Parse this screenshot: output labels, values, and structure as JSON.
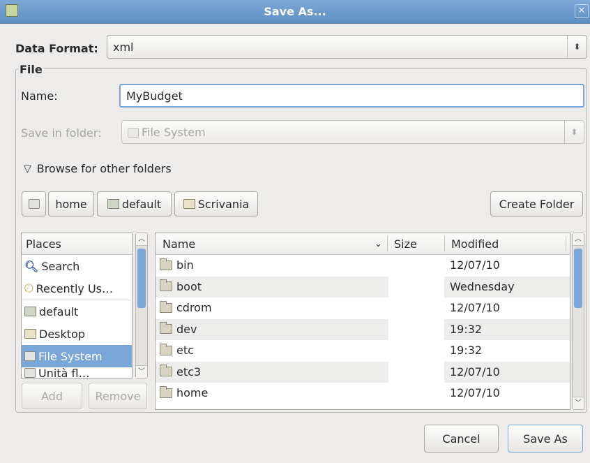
{
  "window": {
    "title": "Save As..."
  },
  "format": {
    "label": "Data Format:",
    "value": "xml"
  },
  "file_section": {
    "title": "File"
  },
  "name": {
    "label": "Name:",
    "value": "MyBudget"
  },
  "folder": {
    "label": "Save in folder:",
    "value": "File System"
  },
  "browse": {
    "label": "Browse for other folders"
  },
  "path_buttons": [
    "home",
    "default",
    "Scrivania"
  ],
  "create_folder": "Create Folder",
  "places": {
    "header": "Places",
    "items": [
      "Search",
      "Recently Us…",
      "default",
      "Desktop",
      "File System",
      "Unità fl…"
    ]
  },
  "place_actions": {
    "add": "Add",
    "remove": "Remove"
  },
  "files": {
    "columns": {
      "name": "Name",
      "size": "Size",
      "modified": "Modified"
    },
    "rows": [
      {
        "name": "bin",
        "modified": "12/07/10"
      },
      {
        "name": "boot",
        "modified": "Wednesday"
      },
      {
        "name": "cdrom",
        "modified": "12/07/10"
      },
      {
        "name": "dev",
        "modified": "19:32"
      },
      {
        "name": "etc",
        "modified": "19:32"
      },
      {
        "name": "etc3",
        "modified": "12/07/10"
      },
      {
        "name": "home",
        "modified": "12/07/10"
      }
    ]
  },
  "actions": {
    "cancel": "Cancel",
    "save": "Save As"
  }
}
